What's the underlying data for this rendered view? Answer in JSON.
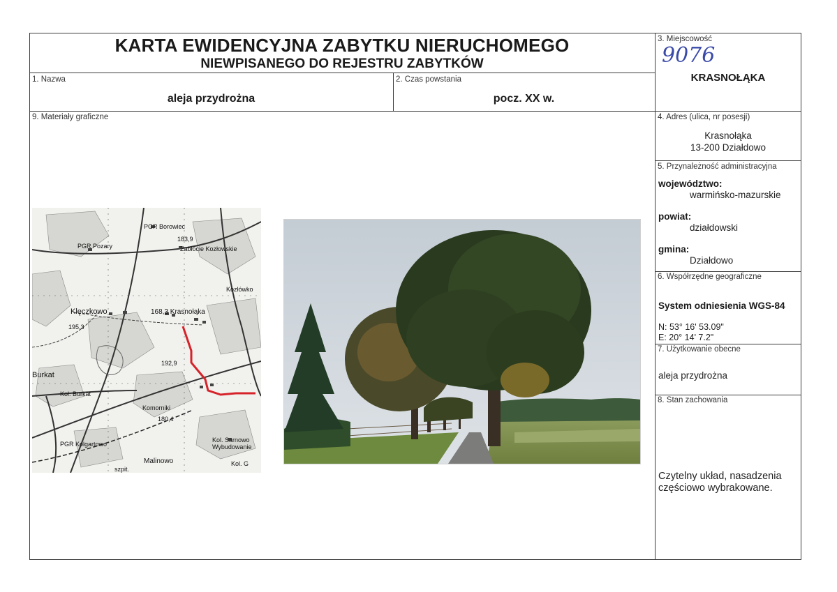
{
  "header": {
    "title_line1": "KARTA EWIDENCYJNA ZABYTKU NIERUCHOMEGO",
    "title_line2": "NIEWPISANEGO DO REJESTRU ZABYTKÓW"
  },
  "fields": {
    "nazwa": {
      "label": "1. Nazwa",
      "value": "aleja przydrożna"
    },
    "czas": {
      "label": "2. Czas powstania",
      "value": "pocz. XX w."
    },
    "miejscowosc": {
      "label": "3. Miejscowość",
      "handwritten": "9076",
      "value": "KRASNOŁĄKA"
    },
    "adres": {
      "label": "4. Adres (ulica, nr posesji)",
      "line1": "Krasnołąka",
      "line2": "13-200 Działdowo"
    },
    "administracja": {
      "label": "5. Przynależność administracyjna",
      "wojewodztwo_label": "województwo:",
      "wojewodztwo": "warmińsko-mazurskie",
      "powiat_label": "powiat:",
      "powiat": "działdowski",
      "gmina_label": "gmina:",
      "gmina": "Działdowo"
    },
    "wspolrzedne": {
      "label": "6. Współrzędne geograficzne",
      "system": "System odniesienia WGS-84",
      "n": "N: 53° 16' 53.09\"",
      "e": "E: 20° 14' 7.2\""
    },
    "uzytkowanie": {
      "label": "7. Użytkowanie obecne",
      "value": "aleja przydrożna"
    },
    "stan": {
      "label": "8. Stan zachowania",
      "line1": "Czytelny układ, nasadzenia",
      "line2": "częściowo wybrakowane."
    },
    "materialy": {
      "label": "9. Materiały graficzne"
    }
  },
  "map_labels": {
    "pgr_borowiec": "PGR Borowiec",
    "h1839": "183,9",
    "zablocie": "Zabłocie Kozłowskie",
    "pgr_pozary": "PGR Pozary",
    "kozlowko": "Kozłówko",
    "kleczkowo": "Klęczkowo",
    "krasnolaka": "168,3 Krasnołąka",
    "n195": "195,3",
    "n192": "192,9",
    "burkat": "Burkat",
    "kol_burkat": "Kol. Burkat",
    "komorniki": "Komorniki",
    "n1804": "180,4",
    "pgr_kolgartowo": "PGR Kolgartowo",
    "kol_sarnowo": "Kol. Sarnowo",
    "wybudowanie": "Wybudowanie",
    "malinowo": "Malinowo",
    "szpit": "szpit.",
    "kol_g": "Kol. G"
  }
}
